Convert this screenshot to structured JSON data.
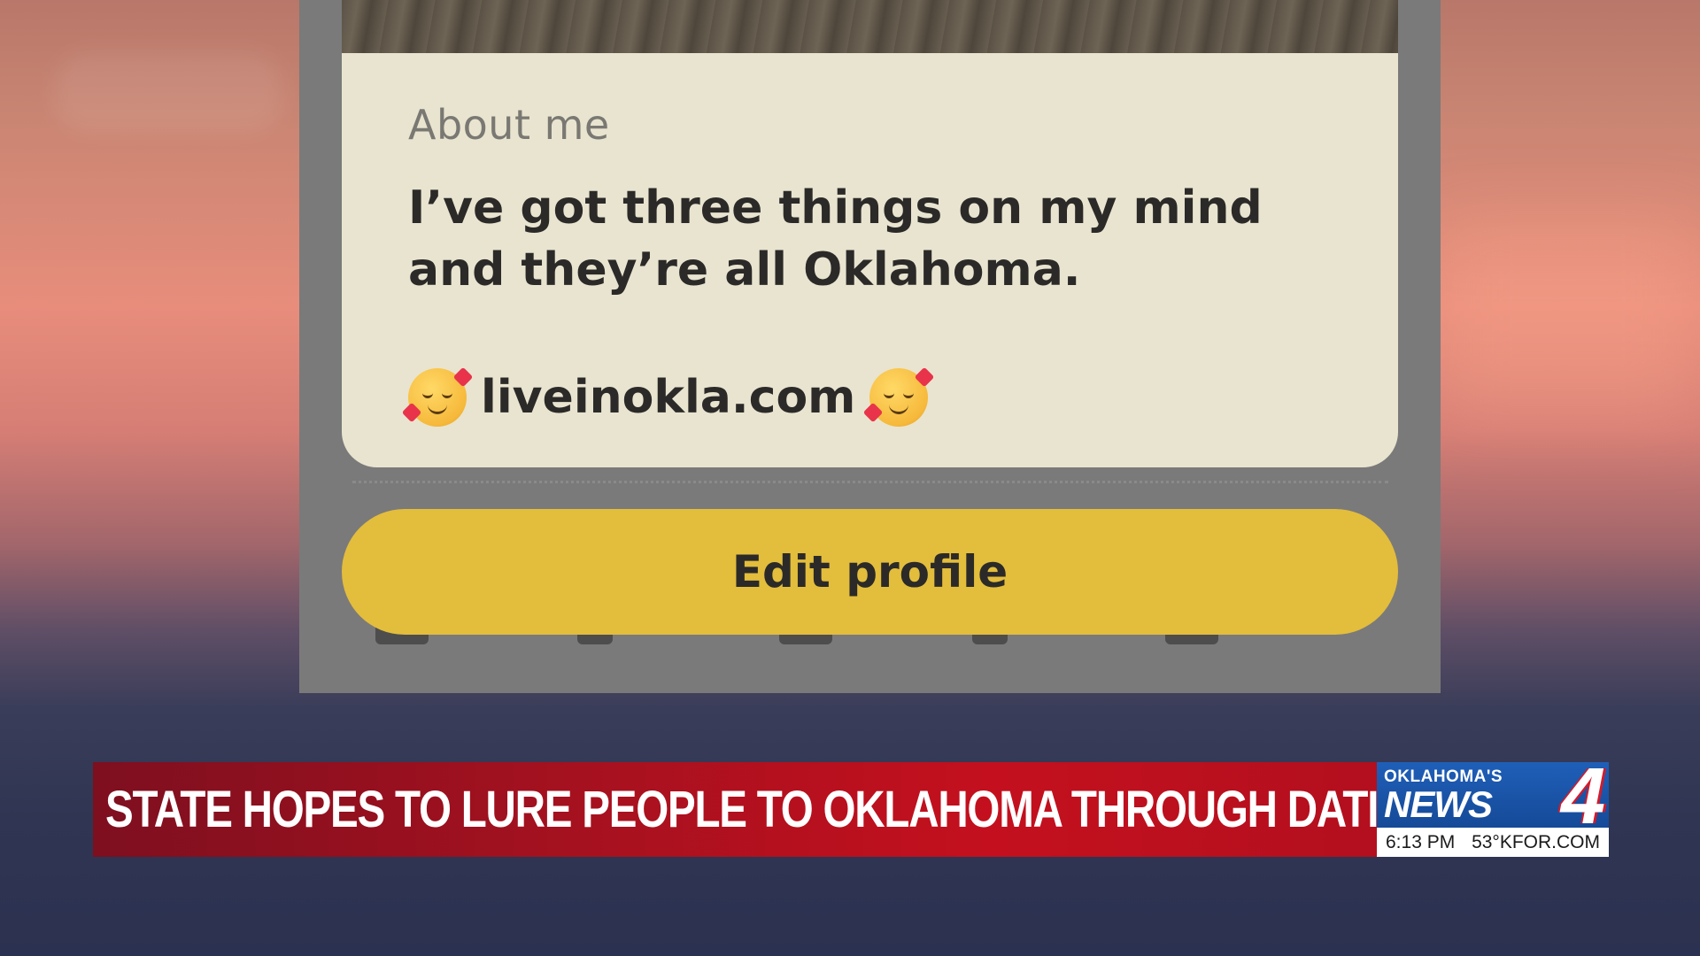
{
  "profile": {
    "about_label": "About me",
    "about_text": "I’ve got three things on my mind and they’re all Oklahoma.",
    "link_text": "liveinokla.com",
    "emoji_icon": "smiling-face-with-hearts-icon",
    "edit_button_label": "Edit profile",
    "button_color": "#e3bd3c",
    "card_color": "#e9e4d0"
  },
  "news": {
    "headline": "STATE HOPES TO LURE PEOPLE TO OKLAHOMA THROUGH DATING APPS",
    "logo_small": "OKLAHOMA'S",
    "logo_news": "NEWS",
    "logo_number": "4",
    "time": "6:13 PM",
    "weather_site": "53°KFOR.COM",
    "banner_color": "#b30f1e",
    "logo_color": "#1f5fb8"
  }
}
